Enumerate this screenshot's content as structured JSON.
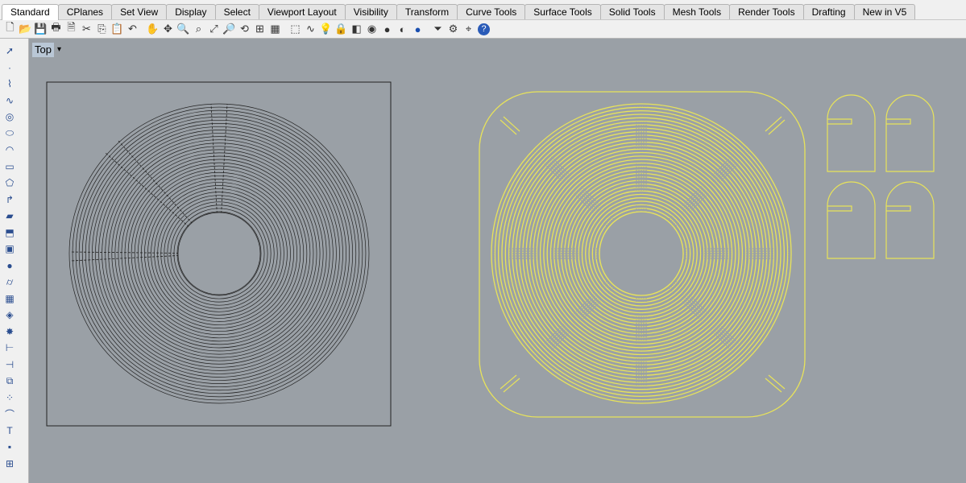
{
  "tabs": [
    "Standard",
    "CPlanes",
    "Set View",
    "Display",
    "Select",
    "Viewport Layout",
    "Visibility",
    "Transform",
    "Curve Tools",
    "Surface Tools",
    "Solid Tools",
    "Mesh Tools",
    "Render Tools",
    "Drafting",
    "New in V5"
  ],
  "active_tab": "Standard",
  "toolbar_icons": [
    "new-file-icon",
    "open-file-icon",
    "save-icon",
    "print-icon",
    "import-icon",
    "cut-icon",
    "copy-icon",
    "paste-icon",
    "undo-icon",
    "pan-icon",
    "rotate-view-icon",
    "zoom-icon",
    "zoom-window-icon",
    "zoom-extents-icon",
    "zoom-selected-icon",
    "undo-view-icon",
    "four-viewports-icon",
    "grid-snap-icon",
    "select-window-icon",
    "curve-icon",
    "lightbulb-icon",
    "lock-icon",
    "layer-icon",
    "color-wheel-icon",
    "sphere-white-icon",
    "sphere-grey-icon",
    "sphere-blue-icon",
    "filter-icon",
    "settings-icon",
    "snap-icon",
    "help-icon"
  ],
  "left_tools": [
    "select-arrow-icon",
    "point-icon",
    "polyline-icon",
    "curve-tool-icon",
    "circle-icon",
    "ellipse-icon",
    "arc-icon",
    "rectangle-icon",
    "polygon-icon",
    "fillet-icon",
    "surface-icon",
    "extrude-icon",
    "box-icon",
    "sphere-icon",
    "cylinder-icon",
    "mesh-icon",
    "boolean-icon",
    "explode-icon",
    "dimension-icon",
    "split-icon",
    "group-icon",
    "point-cloud-icon",
    "bend-icon",
    "text-icon",
    "snap-grid-icon",
    "align-icon"
  ],
  "viewport": {
    "name": "Top",
    "menu_arrow": "▾"
  },
  "colors": {
    "wire": "#222222",
    "selected": "#e8e35a",
    "viewport_bg": "#9aa0a6",
    "label_bg": "#b9c7d6"
  }
}
